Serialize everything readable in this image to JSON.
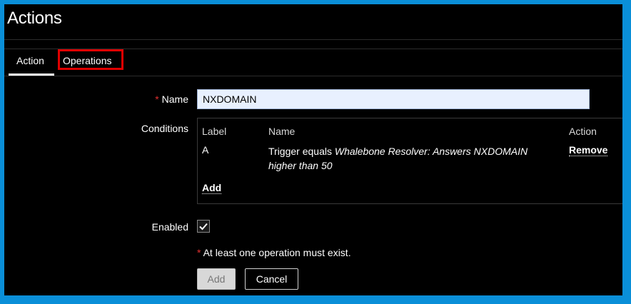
{
  "page": {
    "title": "Actions"
  },
  "tabs": [
    {
      "label": "Action",
      "active": true
    },
    {
      "label": "Operations",
      "highlighted": true
    }
  ],
  "form": {
    "required_marker": "*",
    "name_label": "Name",
    "name_value": "NXDOMAIN",
    "conditions_label": "Conditions",
    "conditions": {
      "headers": {
        "label": "Label",
        "name": "Name",
        "action": "Action"
      },
      "rows": [
        {
          "label": "A",
          "name_prefix": "Trigger equals ",
          "name_italic": "Whalebone Resolver: Answers NXDOMAIN higher than 50",
          "action": "Remove"
        }
      ],
      "add_label": "Add"
    },
    "enabled_label": "Enabled",
    "enabled_checked": true,
    "warning": "At least one operation must exist."
  },
  "buttons": {
    "add": "Add",
    "cancel": "Cancel"
  },
  "colors": {
    "background": "#000000",
    "border": "#0a8fd8",
    "highlight_box": "#e00000",
    "required": "#e03030",
    "input_bg": "#e8f0fe"
  },
  "icons": {
    "checkbox": "checkmark-icon"
  }
}
